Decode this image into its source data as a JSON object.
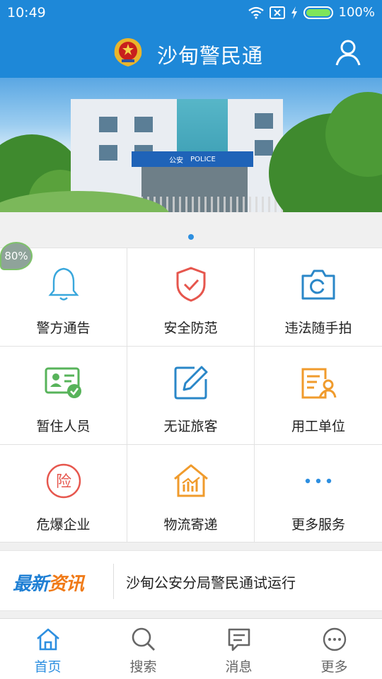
{
  "status_bar": {
    "time": "10:49",
    "battery": "100%"
  },
  "header": {
    "title": "沙甸警民通"
  },
  "banner": {
    "canopy_left": "公安",
    "canopy_right": "POLICE"
  },
  "badge": {
    "text": "80%"
  },
  "services": [
    {
      "label": "警方通告",
      "icon": "bell-icon",
      "color": "#39a7dc"
    },
    {
      "label": "安全防范",
      "icon": "shield-check-icon",
      "color": "#e6564d"
    },
    {
      "label": "违法随手拍",
      "icon": "camera-icon",
      "color": "#2a87c8"
    },
    {
      "label": "暂住人员",
      "icon": "id-card-icon",
      "color": "#57b35a"
    },
    {
      "label": "无证旅客",
      "icon": "edit-icon",
      "color": "#2a87c8"
    },
    {
      "label": "用工单位",
      "icon": "employee-doc-icon",
      "color": "#f09b2c"
    },
    {
      "label": "危爆企业",
      "icon": "insurance-icon",
      "color": "#e6564d"
    },
    {
      "label": "物流寄递",
      "icon": "warehouse-chart-icon",
      "color": "#f09b2c"
    },
    {
      "label": "更多服务",
      "icon": "more-dots-icon",
      "color": "#2d8fe0"
    }
  ],
  "news": {
    "tag_part1": "最新",
    "tag_part2": "资讯",
    "headline": "沙甸公安分局警民通试运行"
  },
  "tabbar": [
    {
      "label": "首页",
      "icon": "home-icon",
      "active": true
    },
    {
      "label": "搜索",
      "icon": "search-icon",
      "active": false
    },
    {
      "label": "消息",
      "icon": "message-icon",
      "active": false
    },
    {
      "label": "更多",
      "icon": "more-icon",
      "active": false
    }
  ],
  "colors": {
    "primary": "#1e88d8",
    "tab_active": "#2d8fe0"
  }
}
